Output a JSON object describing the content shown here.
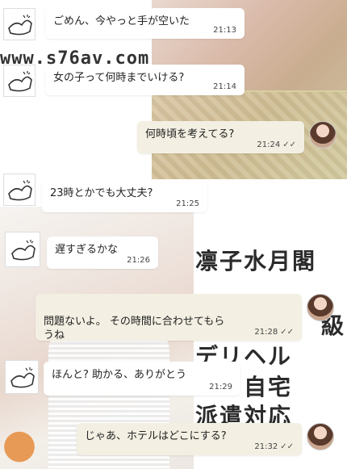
{
  "watermark": "www.s76av.com",
  "overlay_text": [
    "凛子水月閣",
    "級",
    "デリヘル",
    "ル・自宅",
    "派遣対応"
  ],
  "messages": [
    {
      "side": "in",
      "text": "ごめん、今やっと手が空いた",
      "time": "21:13"
    },
    {
      "side": "in",
      "text": "女の子って何時までいける?",
      "time": "21:14"
    },
    {
      "side": "out",
      "text": "何時頃を考えてる?",
      "time": "21:24"
    },
    {
      "side": "in",
      "text": "23時とかでも大丈夫?",
      "time": "21:25"
    },
    {
      "side": "in",
      "text": "遅すぎるかな",
      "time": "21:26"
    },
    {
      "side": "out",
      "text": "問題ないよ。 その時間に合わせてもら\nうね",
      "time": "21:28"
    },
    {
      "side": "in",
      "text": "ほんと? 助かる、ありがとう",
      "time": "21:29"
    },
    {
      "side": "out",
      "text": "じゃあ、ホテルはどこにする?",
      "time": "21:32"
    }
  ]
}
